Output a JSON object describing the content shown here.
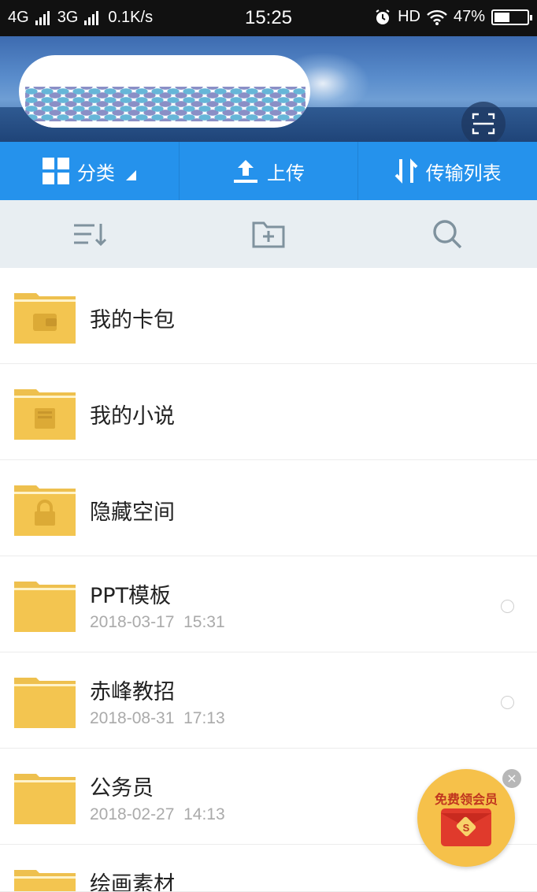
{
  "status_bar": {
    "network1": "4G",
    "network2": "3G",
    "speed": "0.1K/s",
    "time": "15:25",
    "hd": "HD",
    "battery": "47%",
    "battery_level": 0.47
  },
  "header": {
    "scan_icon": "scan-frame-icon"
  },
  "actions": [
    {
      "label": "分类",
      "icon": "grid-icon"
    },
    {
      "label": "上传",
      "icon": "upload-icon"
    },
    {
      "label": "传输列表",
      "icon": "transfer-icon"
    }
  ],
  "toolbar": {
    "sort_icon": "sort-icon",
    "new_folder_icon": "new-folder-icon",
    "search_icon": "search-icon"
  },
  "files": [
    {
      "name": "我的卡包",
      "date": "",
      "time": "",
      "badge_icon": "wallet-icon"
    },
    {
      "name": "我的小说",
      "date": "",
      "time": "",
      "badge_icon": "book-icon"
    },
    {
      "name": "隐藏空间",
      "date": "",
      "time": "",
      "badge_icon": "lock-icon"
    },
    {
      "name": "PPT模板",
      "date": "2018-03-17",
      "time": "15:31"
    },
    {
      "name": "赤峰教招",
      "date": "2018-08-31",
      "time": "17:13"
    },
    {
      "name": "公务员",
      "date": "2018-02-27",
      "time": "14:13"
    },
    {
      "name": "绘画素材",
      "date": "",
      "time": ""
    }
  ],
  "promo": {
    "label": "免费领会员",
    "close": "×"
  }
}
